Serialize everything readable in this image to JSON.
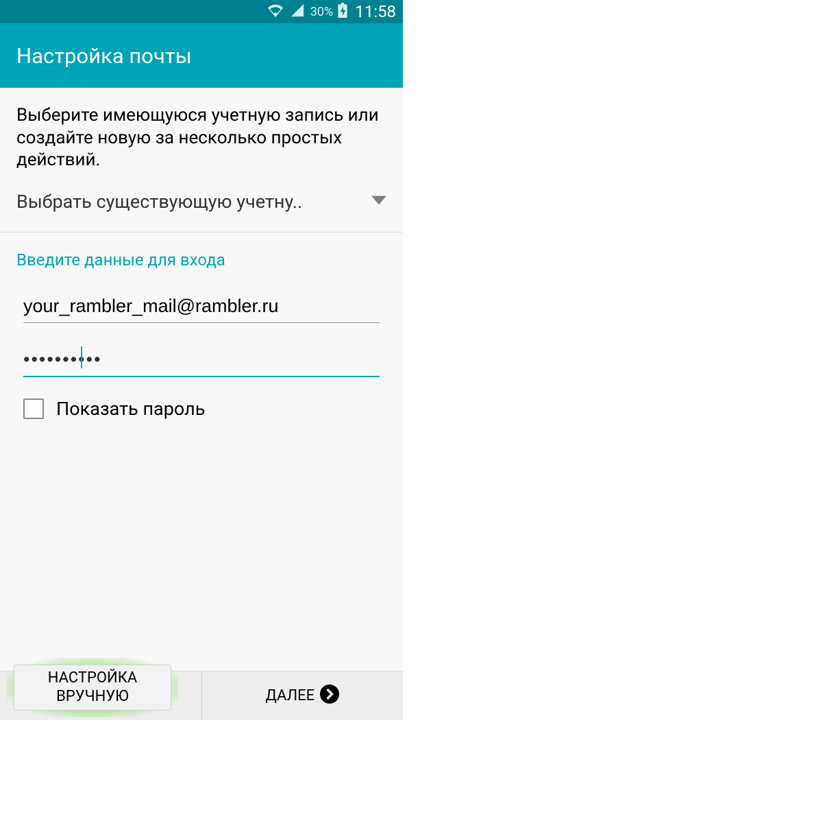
{
  "statusBar": {
    "batteryPercent": "30%",
    "time": "11:58"
  },
  "header": {
    "title": "Настройка почты"
  },
  "content": {
    "instruction": "Выберите имеющуюся учетную запись или создайте новую за несколько простых действий.",
    "dropdown": "Выбрать существующую учетну..",
    "loginHeading": "Введите данные для входа",
    "emailValue": "your_rambler_mail@rambler.ru",
    "passwordValue": "••••••••••",
    "showPasswordLabel": "Показать пароль"
  },
  "footer": {
    "manualLine1": "НАСТРОЙКА",
    "manualLine2": "ВРУЧНУЮ",
    "next": "ДАЛЕЕ"
  }
}
